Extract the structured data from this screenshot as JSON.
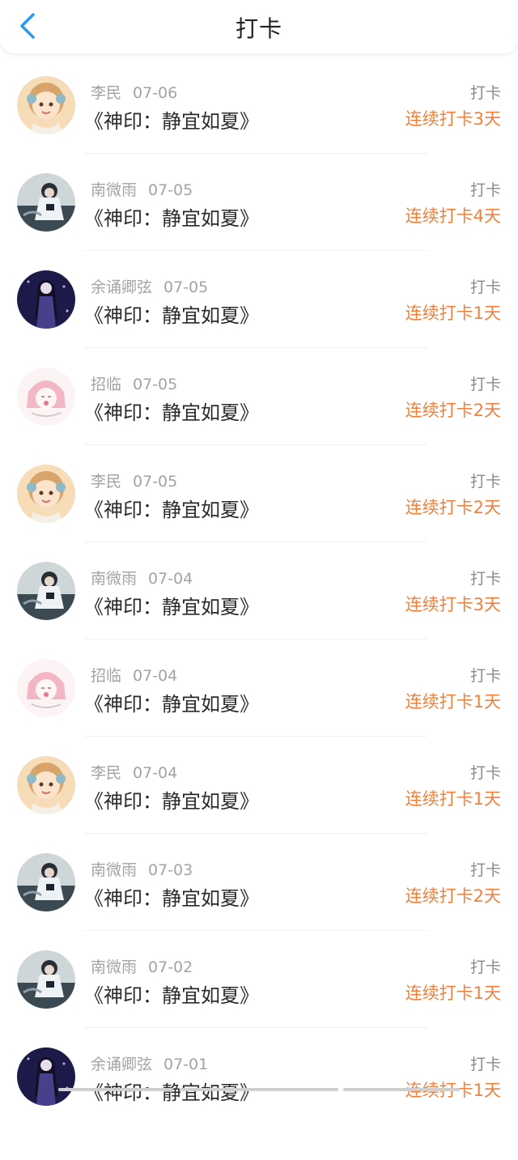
{
  "header": {
    "title": "打卡",
    "back_icon": "chevron-left-icon",
    "back_color": "#2b9af3"
  },
  "colors": {
    "streak": "#f0803a",
    "meta": "#a3a3a3"
  },
  "items": [
    {
      "user": "李民",
      "date": "07-06",
      "book": "《神印：静宜如夏》",
      "tag": "打卡",
      "streak": "连续打卡3天",
      "avatar": "cartoon-girl"
    },
    {
      "user": "南微雨",
      "date": "07-05",
      "book": "《神印：静宜如夏》",
      "tag": "打卡",
      "streak": "连续打卡4天",
      "avatar": "anime-scholar"
    },
    {
      "user": "余诵卿弦",
      "date": "07-05",
      "book": "《神印：静宜如夏》",
      "tag": "打卡",
      "streak": "连续打卡1天",
      "avatar": "night-girl"
    },
    {
      "user": "招临",
      "date": "07-05",
      "book": "《神印：静宜如夏》",
      "tag": "打卡",
      "streak": "连续打卡2天",
      "avatar": "pink-sketch"
    },
    {
      "user": "李民",
      "date": "07-05",
      "book": "《神印：静宜如夏》",
      "tag": "打卡",
      "streak": "连续打卡2天",
      "avatar": "cartoon-girl"
    },
    {
      "user": "南微雨",
      "date": "07-04",
      "book": "《神印：静宜如夏》",
      "tag": "打卡",
      "streak": "连续打卡3天",
      "avatar": "anime-scholar"
    },
    {
      "user": "招临",
      "date": "07-04",
      "book": "《神印：静宜如夏》",
      "tag": "打卡",
      "streak": "连续打卡1天",
      "avatar": "pink-sketch"
    },
    {
      "user": "李民",
      "date": "07-04",
      "book": "《神印：静宜如夏》",
      "tag": "打卡",
      "streak": "连续打卡1天",
      "avatar": "cartoon-girl"
    },
    {
      "user": "南微雨",
      "date": "07-03",
      "book": "《神印：静宜如夏》",
      "tag": "打卡",
      "streak": "连续打卡2天",
      "avatar": "anime-scholar"
    },
    {
      "user": "南微雨",
      "date": "07-02",
      "book": "《神印：静宜如夏》",
      "tag": "打卡",
      "streak": "连续打卡1天",
      "avatar": "anime-scholar"
    },
    {
      "user": "余诵卿弦",
      "date": "07-01",
      "book": "《神印：静宜如夏》",
      "tag": "打卡",
      "streak": "连续打卡1天",
      "avatar": "night-girl"
    }
  ]
}
